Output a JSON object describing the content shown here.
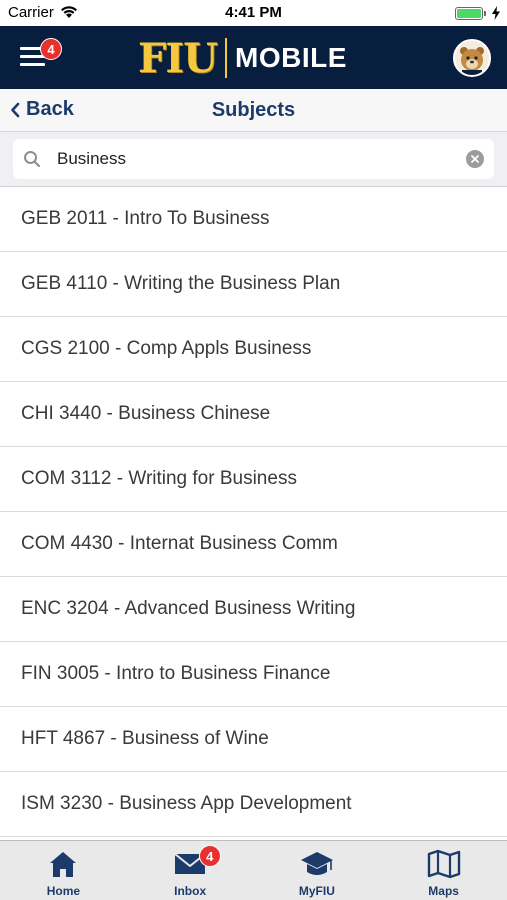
{
  "status_bar": {
    "carrier": "Carrier",
    "time": "4:41 PM"
  },
  "header": {
    "menu_badge": "4",
    "logo_fiu": "FIU",
    "logo_mobile": "MOBILE",
    "avatar_icon": "panther-mascot-icon"
  },
  "nav": {
    "back_label": "Back",
    "title": "Subjects"
  },
  "search": {
    "value": "Business",
    "placeholder": ""
  },
  "courses": [
    "GEB 2011 - Intro To Business",
    "GEB 4110 - Writing the Business Plan",
    "CGS 2100 - Comp Appls Business",
    "CHI 3440 - Business Chinese",
    "COM 3112 - Writing for Business",
    "COM 4430 - Internat Business Comm",
    "ENC 3204 - Advanced Business Writing",
    "FIN 3005 - Intro to Business Finance",
    "HFT 4867 - Business of Wine",
    "ISM 3230 - Business App Development"
  ],
  "tabs": [
    {
      "label": "Home",
      "icon": "home-icon"
    },
    {
      "label": "Inbox",
      "icon": "envelope-icon",
      "badge": "4"
    },
    {
      "label": "MyFIU",
      "icon": "graduation-cap-icon"
    },
    {
      "label": "Maps",
      "icon": "map-icon"
    }
  ],
  "colors": {
    "header_bg": "#081e3f",
    "gold": "#f6c83f",
    "nav_text": "#1c3b6b",
    "badge": "#e8302e",
    "battery": "#4cd964"
  }
}
